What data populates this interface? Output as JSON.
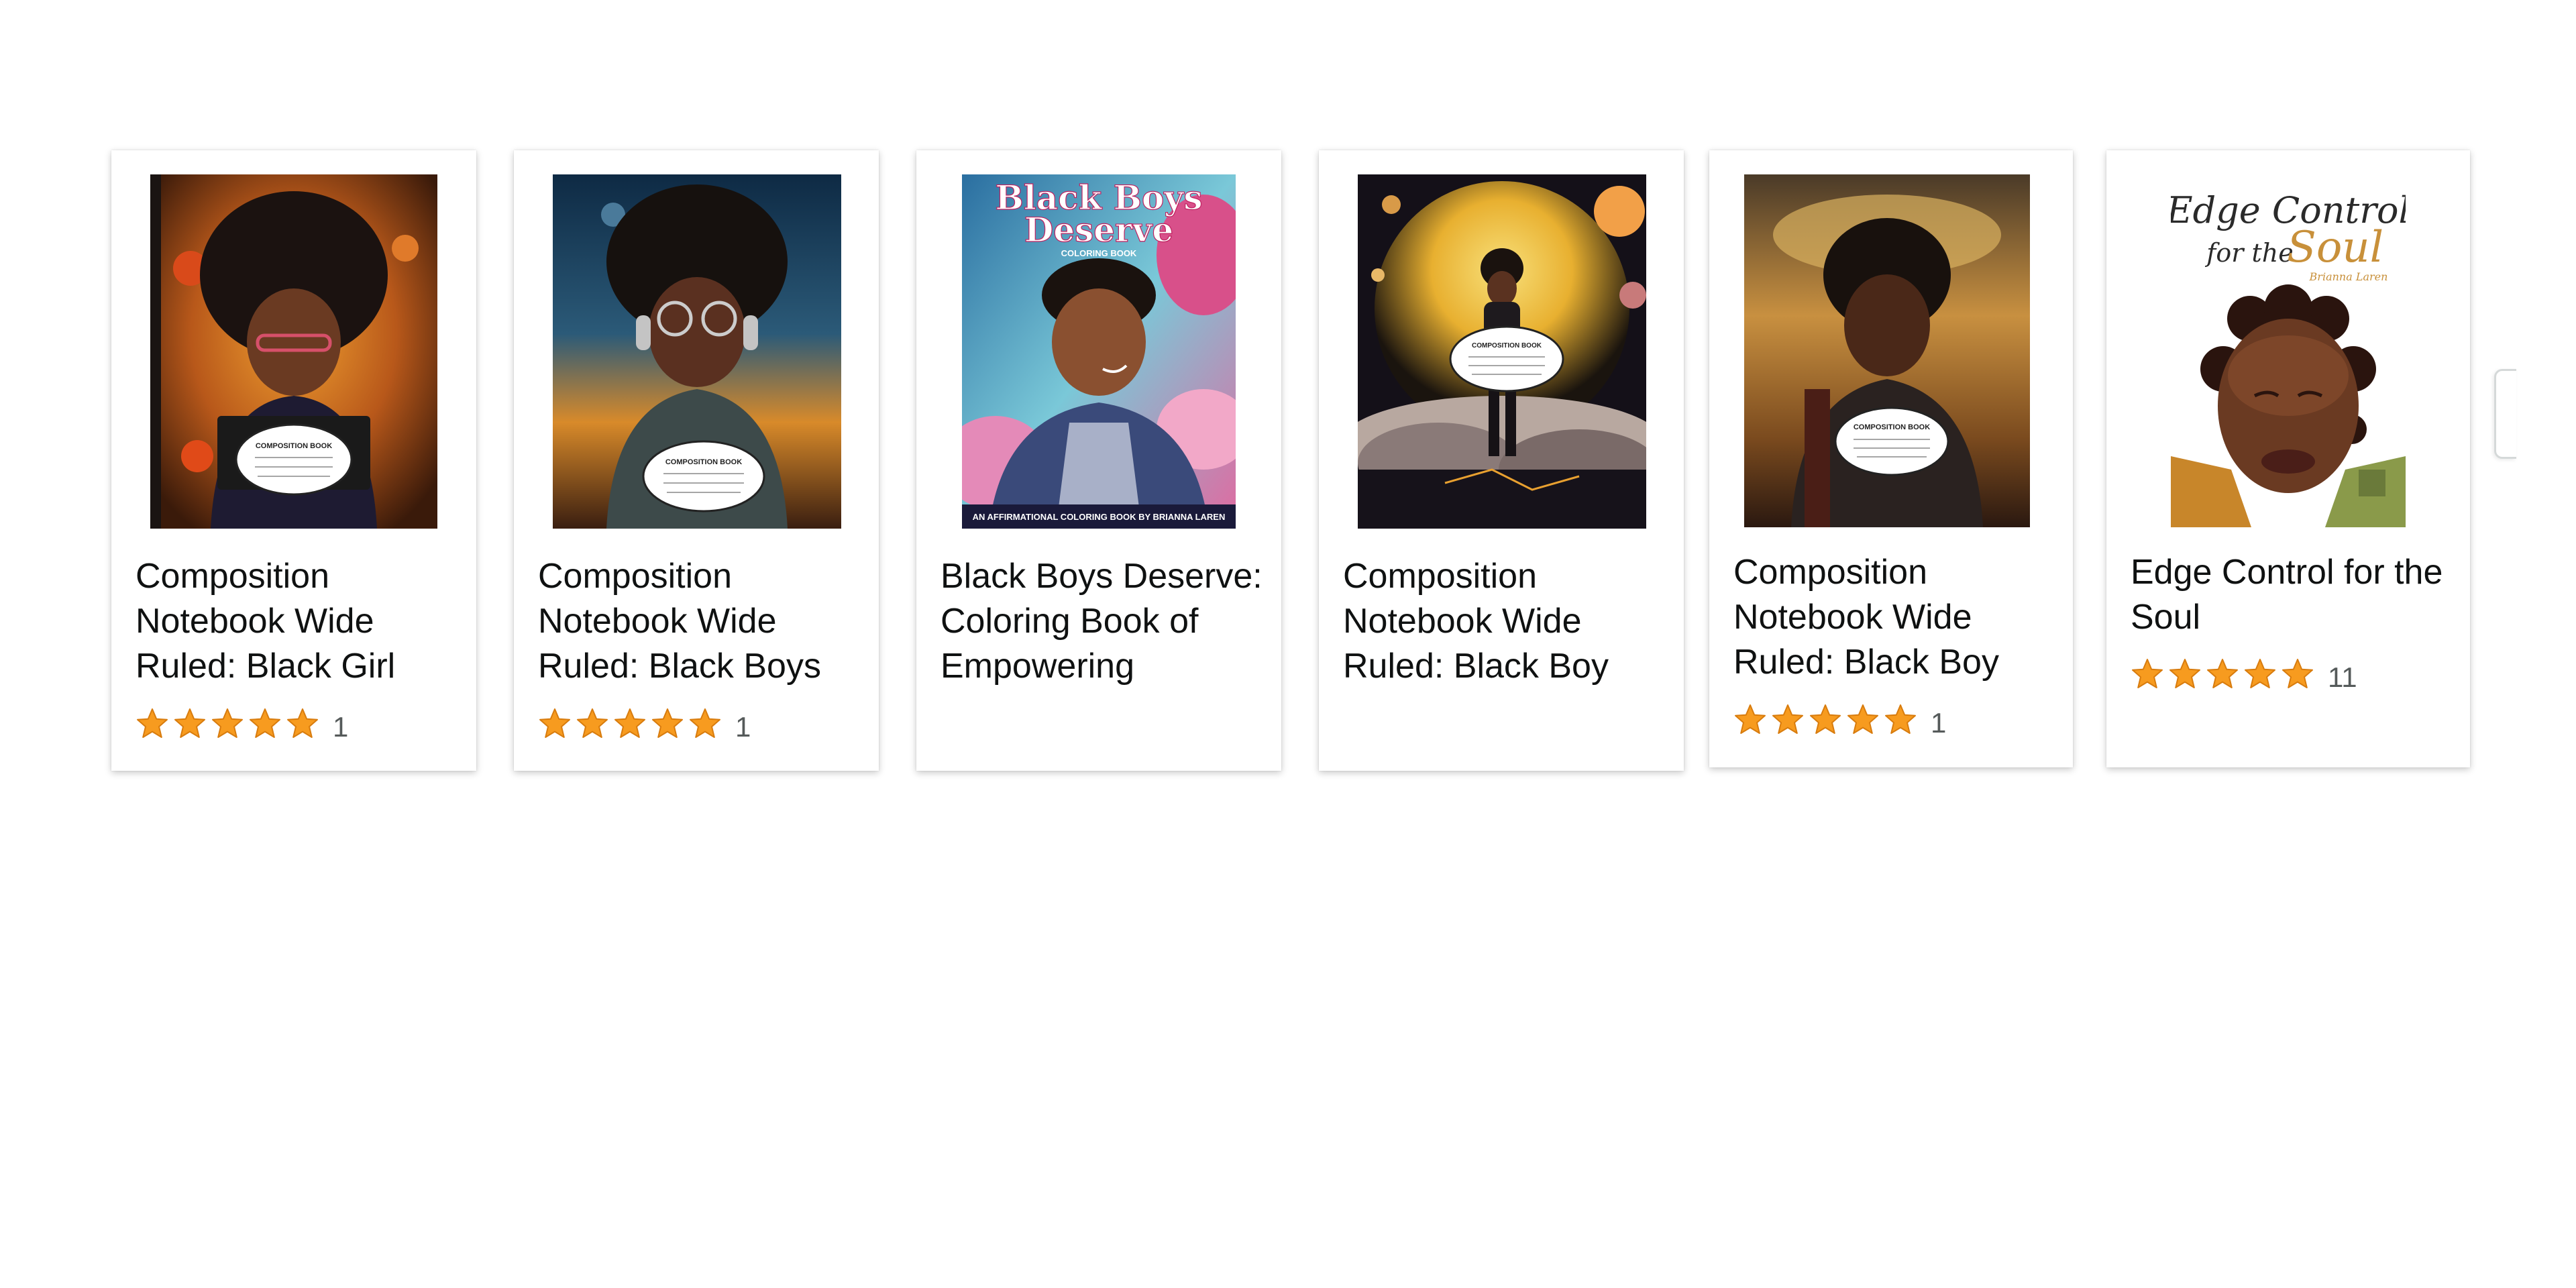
{
  "products": [
    {
      "title": "Composition Notebook Wide Ruled: Black Girl",
      "rating_count": "1",
      "stars": 5,
      "cover": {
        "label": "COMPOSITION BOOK"
      }
    },
    {
      "title": "Composition Notebook Wide Ruled: Black Boys",
      "rating_count": "1",
      "stars": 5,
      "cover": {
        "label": "COMPOSITION BOOK"
      }
    },
    {
      "title": "Black Boys Deserve: Coloring Book of Empowering",
      "rating_count": "",
      "stars": 0,
      "cover": {
        "title_line1": "Black Boys",
        "title_line2": "Deserve",
        "subtitle": "COLORING BOOK",
        "footer": "AN AFFIRMATIONAL COLORING BOOK BY BRIANNA LAREN"
      }
    },
    {
      "title": "Composition Notebook Wide Ruled: Black Boy",
      "rating_count": "",
      "stars": 0,
      "cover": {
        "label": "COMPOSITION BOOK"
      }
    },
    {
      "title": "Composition Notebook Wide Ruled: Black Boy",
      "rating_count": "1",
      "stars": 5,
      "cover": {
        "label": "COMPOSITION BOOK"
      }
    },
    {
      "title": "Edge Control for the Soul",
      "rating_count": "11",
      "stars": 5,
      "cover": {
        "line1": "Edge Control",
        "line2a": "for the",
        "line2b": "Soul",
        "author": "Brianna Laren"
      }
    }
  ],
  "colors": {
    "star": "#f79b1f",
    "star_stroke": "#d87c0e",
    "title_text": "#0f1111",
    "count_text": "#555a5a"
  },
  "icons": {
    "star": "star-icon",
    "next": "chevron-right-icon"
  }
}
